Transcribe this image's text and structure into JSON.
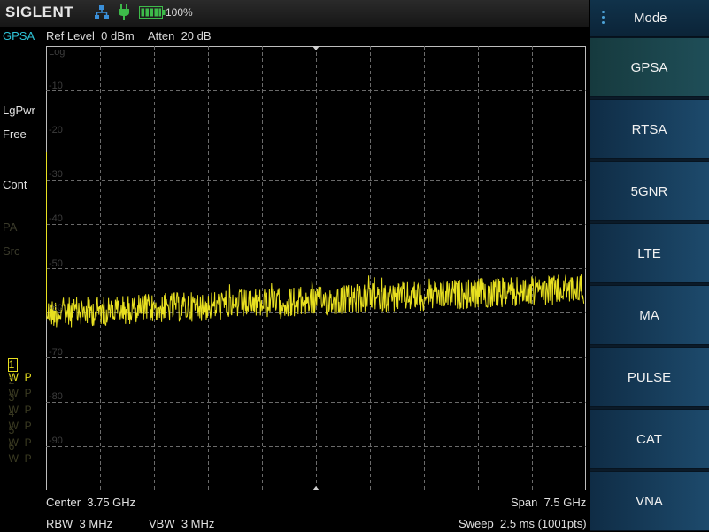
{
  "header": {
    "brand": "SIGLENT",
    "battery_percent": "100%",
    "icons": [
      "network-icon",
      "power-plug-icon",
      "battery-icon"
    ]
  },
  "info": {
    "mode": "GPSA",
    "ref_level": "Ref Level  0 dBm",
    "atten": "Atten  20 dB"
  },
  "left_panel": {
    "scale_type": "LgPwr",
    "trigger": "Free",
    "sweep_mode": "Cont",
    "pa": "PA",
    "src": "Src",
    "traces": [
      {
        "num": "1",
        "label": "W  P"
      },
      {
        "num": "2",
        "label": "W  P"
      },
      {
        "num": "3",
        "label": "W  P"
      },
      {
        "num": "4",
        "label": "W  P"
      },
      {
        "num": "5",
        "label": "W  P"
      },
      {
        "num": "6",
        "label": "W  P"
      }
    ]
  },
  "plot": {
    "scale_label": "Log",
    "y_ticks": [
      "-10",
      "-20",
      "-30",
      "-40",
      "-50",
      "-60",
      "-70",
      "-80",
      "-90"
    ],
    "trace_color": "#e8e020"
  },
  "footer": {
    "center": "Center  3.75 GHz",
    "span": "Span  7.5 GHz",
    "rbw": "RBW  3 MHz",
    "vbw": "VBW  3 MHz",
    "sweep": "Sweep  2.5 ms (1001pts)"
  },
  "menu": {
    "title": "Mode",
    "items": [
      "GPSA",
      "RTSA",
      "5GNR",
      "LTE",
      "MA",
      "PULSE",
      "CAT",
      "VNA"
    ],
    "selected": "GPSA"
  }
}
